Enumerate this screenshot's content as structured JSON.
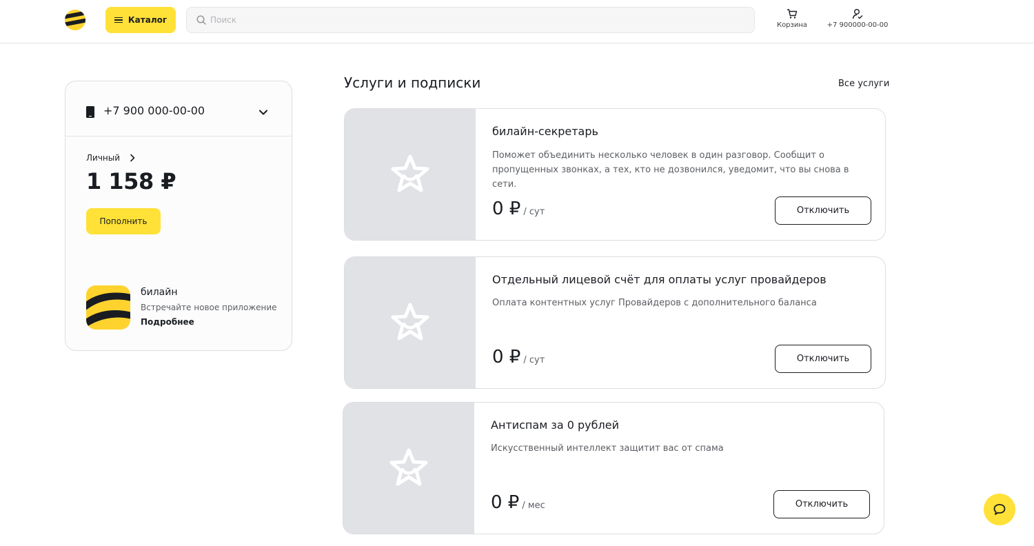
{
  "header": {
    "logo_icon": "beeline-logo-icon",
    "catalog_label": "Каталог",
    "search_placeholder": "Поиск",
    "cart_label": "Корзина",
    "profile_label": "+7 900000-00-00"
  },
  "account": {
    "number": "+7 900 000-00-00",
    "type_label": "Личный",
    "balance": "1 158 ₽",
    "topup_label": "Пополнить",
    "app": {
      "title": "билайн",
      "description": "Встречайте новое приложение",
      "more_label": "Подробнее"
    }
  },
  "section": {
    "title": "Услуги и подписки",
    "all_link": "Все услуги"
  },
  "services": [
    {
      "title": "билайн-секретарь",
      "description": "Поможет объединить несколько человек в один разговор. Сообщит о пропущенных звонках, а тех, кто не дозвонился, уведомит, что вы снова в сети.",
      "price": "0 ₽",
      "period": "/ сут",
      "button": "Отключить"
    },
    {
      "title": "Отдельный лицевой счёт для оплаты услуг провайдеров",
      "description": "Оплата контентных услуг Провайдеров с дополнительного баланса",
      "price": "0 ₽",
      "period": "/ сут",
      "button": "Отключить"
    },
    {
      "title": "Антиспам за 0 рублей",
      "description": "Искусственный интеллект защитит вас от спама",
      "price": "0 ₽",
      "period": "/ мес",
      "button": "Отключить"
    }
  ],
  "colors": {
    "accent": "#ffe137",
    "text": "#191c21",
    "muted": "#5b5e63",
    "image_bg": "#e1e2e6"
  }
}
